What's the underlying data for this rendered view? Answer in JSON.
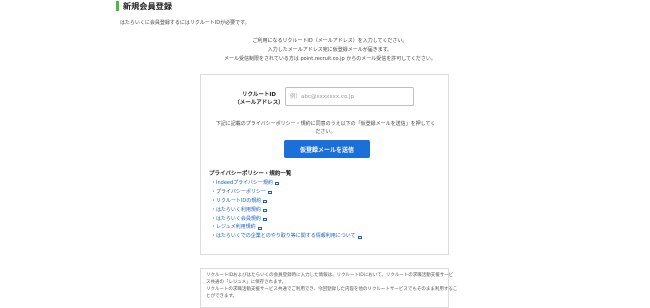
{
  "page_title": "新規会員登録",
  "intro_text": "はたらいくに会員登録するにはリクルートIDが必要です。",
  "notice_lines": [
    "ご利用になるリクルートID（メールアドレス）を入力してください。",
    "入力したメールアドレス宛に仮登録メールが届きます。",
    "メール受信制限をされている方は point.recruit.co.jp からのメール受信を許可してください。"
  ],
  "form": {
    "id_label_line1": "リクルートID",
    "id_label_line2": "（メールアドレス）",
    "email_placeholder": "例）abc@xxxxxxx.co.jp",
    "email_value": "",
    "agree_line1": "下記に記載のプライバシーポリシー・規約に同意のうえ以下の「仮登録メールを送信」を押してく",
    "agree_line2": "ださい。",
    "submit_label": "仮登録メールを送信"
  },
  "policies": {
    "heading": "プライバシーポリシー・規約一覧",
    "items": [
      "Indeedプライバシー規約",
      "プライバシーポリシー",
      "リクルートIDの規約",
      "はたらいく利用規約",
      "はたらいく会員規約",
      "レジュメ利用規約",
      "はたらいくでの企業とのやり取り等に関する情報利用について"
    ]
  },
  "footer_lines": [
    "リクルートIDおよびはたらいくの会員登録時に入力した情報は、リクルートIDにおいて、リクルートの求職活動支援サービ",
    "ス共通の「レジュメ」に保存されます。",
    "リクルートの求職活動支援サービス共通でご利用でき、今回登録した内容を他のリクルートサービスでもそのまま利用するこ",
    "とができます。"
  ],
  "colors": {
    "accent_bar": "#4cb848",
    "button": "#1a6fd8",
    "link": "#1a5fc4"
  }
}
